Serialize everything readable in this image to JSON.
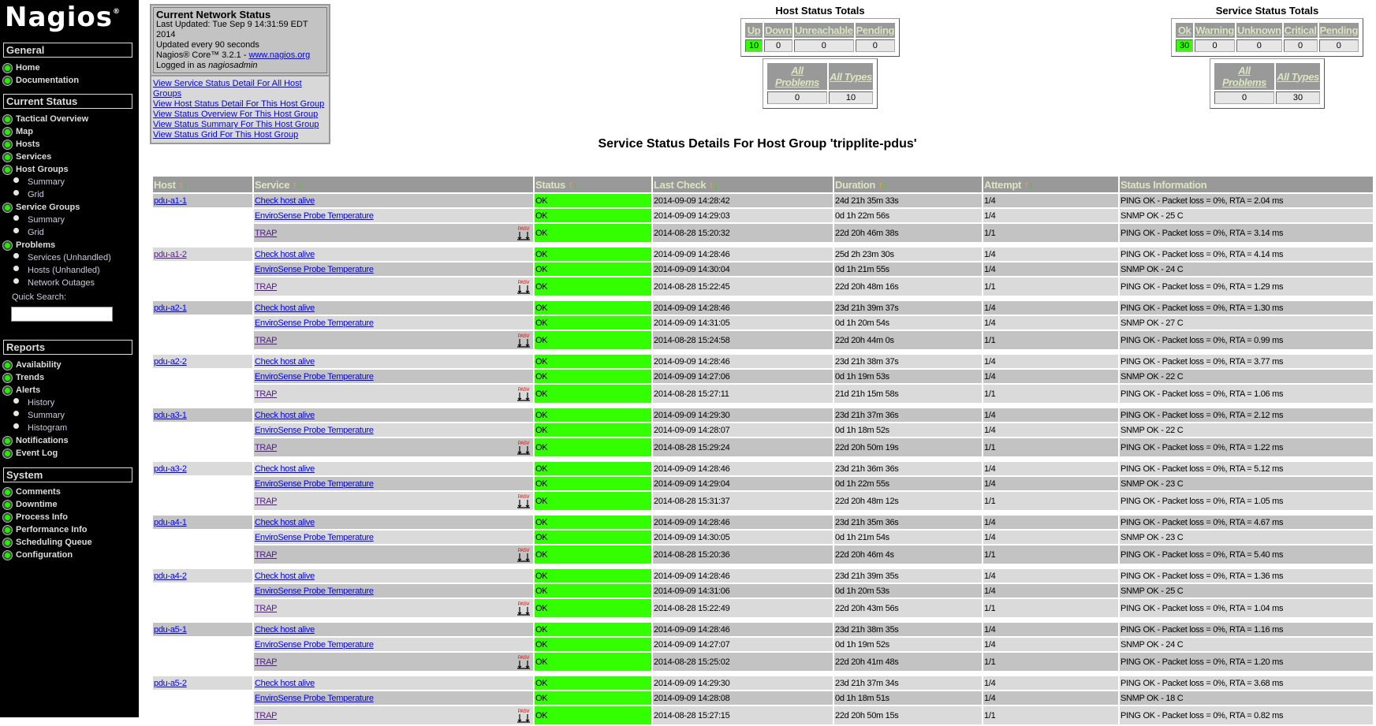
{
  "sidebar": {
    "logo": "Nagios",
    "general": {
      "title": "General",
      "items": [
        "Home",
        "Documentation"
      ]
    },
    "current": {
      "title": "Current Status",
      "items": [
        "Tactical Overview",
        "Map",
        "Hosts",
        "Services",
        "Host Groups"
      ],
      "host_groups_sub": [
        "Summary",
        "Grid"
      ],
      "service_groups": "Service Groups",
      "service_groups_sub": [
        "Summary",
        "Grid"
      ],
      "problems": "Problems",
      "problems_sub": [
        "Services (Unhandled)",
        "Hosts (Unhandled)",
        "Network Outages"
      ],
      "quick_search_label": "Quick Search:",
      "quick_search_value": ""
    },
    "reports": {
      "title": "Reports",
      "items": [
        "Availability",
        "Trends",
        "Alerts"
      ],
      "alerts_sub": [
        "History",
        "Summary",
        "Histogram"
      ],
      "items2": [
        "Notifications",
        "Event Log"
      ]
    },
    "system": {
      "title": "System",
      "items": [
        "Comments",
        "Downtime",
        "Process Info",
        "Performance Info",
        "Scheduling Queue",
        "Configuration"
      ]
    }
  },
  "info": {
    "title": "Current Network Status",
    "last_updated": "Last Updated: Tue Sep 9 14:31:59 EDT 2014",
    "interval": "Updated every 90 seconds",
    "version": "Nagios® Core™ 3.2.1 - ",
    "site": "www.nagios.org",
    "logged_prefix": "Logged in as ",
    "user": "nagiosadmin",
    "links": [
      "View Service Status Detail For All Host Groups",
      "View Host Status Detail For This Host Group",
      "View Status Overview For This Host Group",
      "View Status Summary For This Host Group",
      "View Status Grid For This Host Group"
    ]
  },
  "host_totals": {
    "title": "Host Status Totals",
    "headers": [
      "Up",
      "Down",
      "Unreachable",
      "Pending"
    ],
    "values": [
      "10",
      "0",
      "0",
      "0"
    ],
    "headers2": [
      "All Problems",
      "All Types"
    ],
    "values2": [
      "0",
      "10"
    ]
  },
  "service_totals": {
    "title": "Service Status Totals",
    "headers": [
      "Ok",
      "Warning",
      "Unknown",
      "Critical",
      "Pending"
    ],
    "values": [
      "30",
      "0",
      "0",
      "0",
      "0"
    ],
    "headers2": [
      "All Problems",
      "All Types"
    ],
    "values2": [
      "0",
      "30"
    ]
  },
  "colors": {
    "ok": "#33ff00",
    "header": "#999999",
    "row_dark": "#c3c3c3",
    "row_light": "#dadada"
  },
  "page_title": "Service Status Details For Host Group 'tripplite-pdus'",
  "table": {
    "headers": [
      "Host",
      "Service",
      "Status",
      "Last Check",
      "Duration",
      "Attempt",
      "Status Information"
    ],
    "hosts": [
      {
        "name": "pdu-a1-1",
        "visited": false,
        "services": [
          {
            "name": "Check host alive",
            "status": "OK",
            "last_check": "2014-09-09 14:28:42",
            "duration": "24d 21h 35m 33s",
            "attempt": "1/4",
            "info": "PING OK - Packet loss = 0%, RTA = 2.04 ms"
          },
          {
            "name": "EnviroSense Probe Temperature",
            "status": "OK",
            "last_check": "2014-09-09 14:29:03",
            "duration": "0d 1h 22m 56s",
            "attempt": "1/4",
            "info": "SNMP OK - 25 C"
          },
          {
            "name": "TRAP",
            "passive": true,
            "status": "OK",
            "last_check": "2014-08-28 15:20:32",
            "duration": "22d 20h 46m 38s",
            "attempt": "1/1",
            "info": "PING OK - Packet loss = 0%, RTA = 3.14 ms"
          }
        ]
      },
      {
        "name": "pdu-a1-2",
        "visited": true,
        "services": [
          {
            "name": "Check host alive",
            "status": "OK",
            "last_check": "2014-09-09 14:28:46",
            "duration": "25d 2h 23m 30s",
            "attempt": "1/4",
            "info": "PING OK - Packet loss = 0%, RTA = 4.14 ms"
          },
          {
            "name": "EnviroSense Probe Temperature",
            "status": "OK",
            "last_check": "2014-09-09 14:30:04",
            "duration": "0d 1h 21m 55s",
            "attempt": "1/4",
            "info": "SNMP OK - 24 C"
          },
          {
            "name": "TRAP",
            "passive": true,
            "status": "OK",
            "last_check": "2014-08-28 15:22:45",
            "duration": "22d 20h 48m 16s",
            "attempt": "1/1",
            "info": "PING OK - Packet loss = 0%, RTA = 1.29 ms"
          }
        ]
      },
      {
        "name": "pdu-a2-1",
        "visited": false,
        "services": [
          {
            "name": "Check host alive",
            "status": "OK",
            "last_check": "2014-09-09 14:28:46",
            "duration": "23d 21h 39m 37s",
            "attempt": "1/4",
            "info": "PING OK - Packet loss = 0%, RTA = 1.30 ms"
          },
          {
            "name": "EnviroSense Probe Temperature",
            "status": "OK",
            "last_check": "2014-09-09 14:31:05",
            "duration": "0d 1h 20m 54s",
            "attempt": "1/4",
            "info": "SNMP OK - 27 C"
          },
          {
            "name": "TRAP",
            "passive": true,
            "status": "OK",
            "last_check": "2014-08-28 15:24:58",
            "duration": "22d 20h 44m 0s",
            "attempt": "1/1",
            "info": "PING OK - Packet loss = 0%, RTA = 0.99 ms"
          }
        ]
      },
      {
        "name": "pdu-a2-2",
        "visited": false,
        "services": [
          {
            "name": "Check host alive",
            "status": "OK",
            "last_check": "2014-09-09 14:28:46",
            "duration": "23d 21h 38m 37s",
            "attempt": "1/4",
            "info": "PING OK - Packet loss = 0%, RTA = 3.77 ms"
          },
          {
            "name": "EnviroSense Probe Temperature",
            "status": "OK",
            "last_check": "2014-09-09 14:27:06",
            "duration": "0d 1h 19m 53s",
            "attempt": "1/4",
            "info": "SNMP OK - 22 C"
          },
          {
            "name": "TRAP",
            "passive": true,
            "status": "OK",
            "last_check": "2014-08-28 15:27:11",
            "duration": "21d 21h 15m 58s",
            "attempt": "1/1",
            "info": "PING OK - Packet loss = 0%, RTA = 1.06 ms"
          }
        ]
      },
      {
        "name": "pdu-a3-1",
        "visited": false,
        "services": [
          {
            "name": "Check host alive",
            "status": "OK",
            "last_check": "2014-09-09 14:29:30",
            "duration": "23d 21h 37m 36s",
            "attempt": "1/4",
            "info": "PING OK - Packet loss = 0%, RTA = 2.12 ms"
          },
          {
            "name": "EnviroSense Probe Temperature",
            "status": "OK",
            "last_check": "2014-09-09 14:28:07",
            "duration": "0d 1h 18m 52s",
            "attempt": "1/4",
            "info": "SNMP OK - 22 C"
          },
          {
            "name": "TRAP",
            "passive": true,
            "status": "OK",
            "last_check": "2014-08-28 15:29:24",
            "duration": "22d 20h 50m 19s",
            "attempt": "1/1",
            "info": "PING OK - Packet loss = 0%, RTA = 1.22 ms"
          }
        ]
      },
      {
        "name": "pdu-a3-2",
        "visited": false,
        "services": [
          {
            "name": "Check host alive",
            "status": "OK",
            "last_check": "2014-09-09 14:28:46",
            "duration": "23d 21h 36m 36s",
            "attempt": "1/4",
            "info": "PING OK - Packet loss = 0%, RTA = 5.12 ms"
          },
          {
            "name": "EnviroSense Probe Temperature",
            "status": "OK",
            "last_check": "2014-09-09 14:29:04",
            "duration": "0d 1h 22m 55s",
            "attempt": "1/4",
            "info": "SNMP OK - 23 C"
          },
          {
            "name": "TRAP",
            "passive": true,
            "status": "OK",
            "last_check": "2014-08-28 15:31:37",
            "duration": "22d 20h 48m 12s",
            "attempt": "1/1",
            "info": "PING OK - Packet loss = 0%, RTA = 1.05 ms"
          }
        ]
      },
      {
        "name": "pdu-a4-1",
        "visited": false,
        "services": [
          {
            "name": "Check host alive",
            "status": "OK",
            "last_check": "2014-09-09 14:28:46",
            "duration": "23d 21h 35m 36s",
            "attempt": "1/4",
            "info": "PING OK - Packet loss = 0%, RTA = 4.67 ms"
          },
          {
            "name": "EnviroSense Probe Temperature",
            "status": "OK",
            "last_check": "2014-09-09 14:30:05",
            "duration": "0d 1h 21m 54s",
            "attempt": "1/4",
            "info": "SNMP OK - 23 C"
          },
          {
            "name": "TRAP",
            "passive": true,
            "status": "OK",
            "last_check": "2014-08-28 15:20:36",
            "duration": "22d 20h 46m 4s",
            "attempt": "1/1",
            "info": "PING OK - Packet loss = 0%, RTA = 5.40 ms"
          }
        ]
      },
      {
        "name": "pdu-a4-2",
        "visited": false,
        "services": [
          {
            "name": "Check host alive",
            "status": "OK",
            "last_check": "2014-09-09 14:28:46",
            "duration": "23d 21h 39m 35s",
            "attempt": "1/4",
            "info": "PING OK - Packet loss = 0%, RTA = 1.36 ms"
          },
          {
            "name": "EnviroSense Probe Temperature",
            "status": "OK",
            "last_check": "2014-09-09 14:31:06",
            "duration": "0d 1h 20m 53s",
            "attempt": "1/4",
            "info": "SNMP OK - 25 C"
          },
          {
            "name": "TRAP",
            "passive": true,
            "status": "OK",
            "last_check": "2014-08-28 15:22:49",
            "duration": "22d 20h 43m 56s",
            "attempt": "1/1",
            "info": "PING OK - Packet loss = 0%, RTA = 1.04 ms"
          }
        ]
      },
      {
        "name": "pdu-a5-1",
        "visited": false,
        "services": [
          {
            "name": "Check host alive",
            "status": "OK",
            "last_check": "2014-09-09 14:28:46",
            "duration": "23d 21h 38m 35s",
            "attempt": "1/4",
            "info": "PING OK - Packet loss = 0%, RTA = 1.16 ms"
          },
          {
            "name": "EnviroSense Probe Temperature",
            "status": "OK",
            "last_check": "2014-09-09 14:27:07",
            "duration": "0d 1h 19m 52s",
            "attempt": "1/4",
            "info": "SNMP OK - 24 C"
          },
          {
            "name": "TRAP",
            "passive": true,
            "status": "OK",
            "last_check": "2014-08-28 15:25:02",
            "duration": "22d 20h 41m 48s",
            "attempt": "1/1",
            "info": "PING OK - Packet loss = 0%, RTA = 1.20 ms"
          }
        ]
      },
      {
        "name": "pdu-a5-2",
        "visited": false,
        "services": [
          {
            "name": "Check host alive",
            "status": "OK",
            "last_check": "2014-09-09 14:29:30",
            "duration": "23d 21h 37m 34s",
            "attempt": "1/4",
            "info": "PING OK - Packet loss = 0%, RTA = 3.68 ms"
          },
          {
            "name": "EnviroSense Probe Temperature",
            "status": "OK",
            "last_check": "2014-09-09 14:28:08",
            "duration": "0d 1h 18m 51s",
            "attempt": "1/4",
            "info": "SNMP OK - 18 C"
          },
          {
            "name": "TRAP",
            "passive": true,
            "status": "OK",
            "last_check": "2014-08-28 15:27:15",
            "duration": "22d 20h 50m 15s",
            "attempt": "1/1",
            "info": "PING OK - Packet loss = 0%, RTA = 0.82 ms"
          }
        ]
      }
    ]
  },
  "pasv_label": "PASV"
}
